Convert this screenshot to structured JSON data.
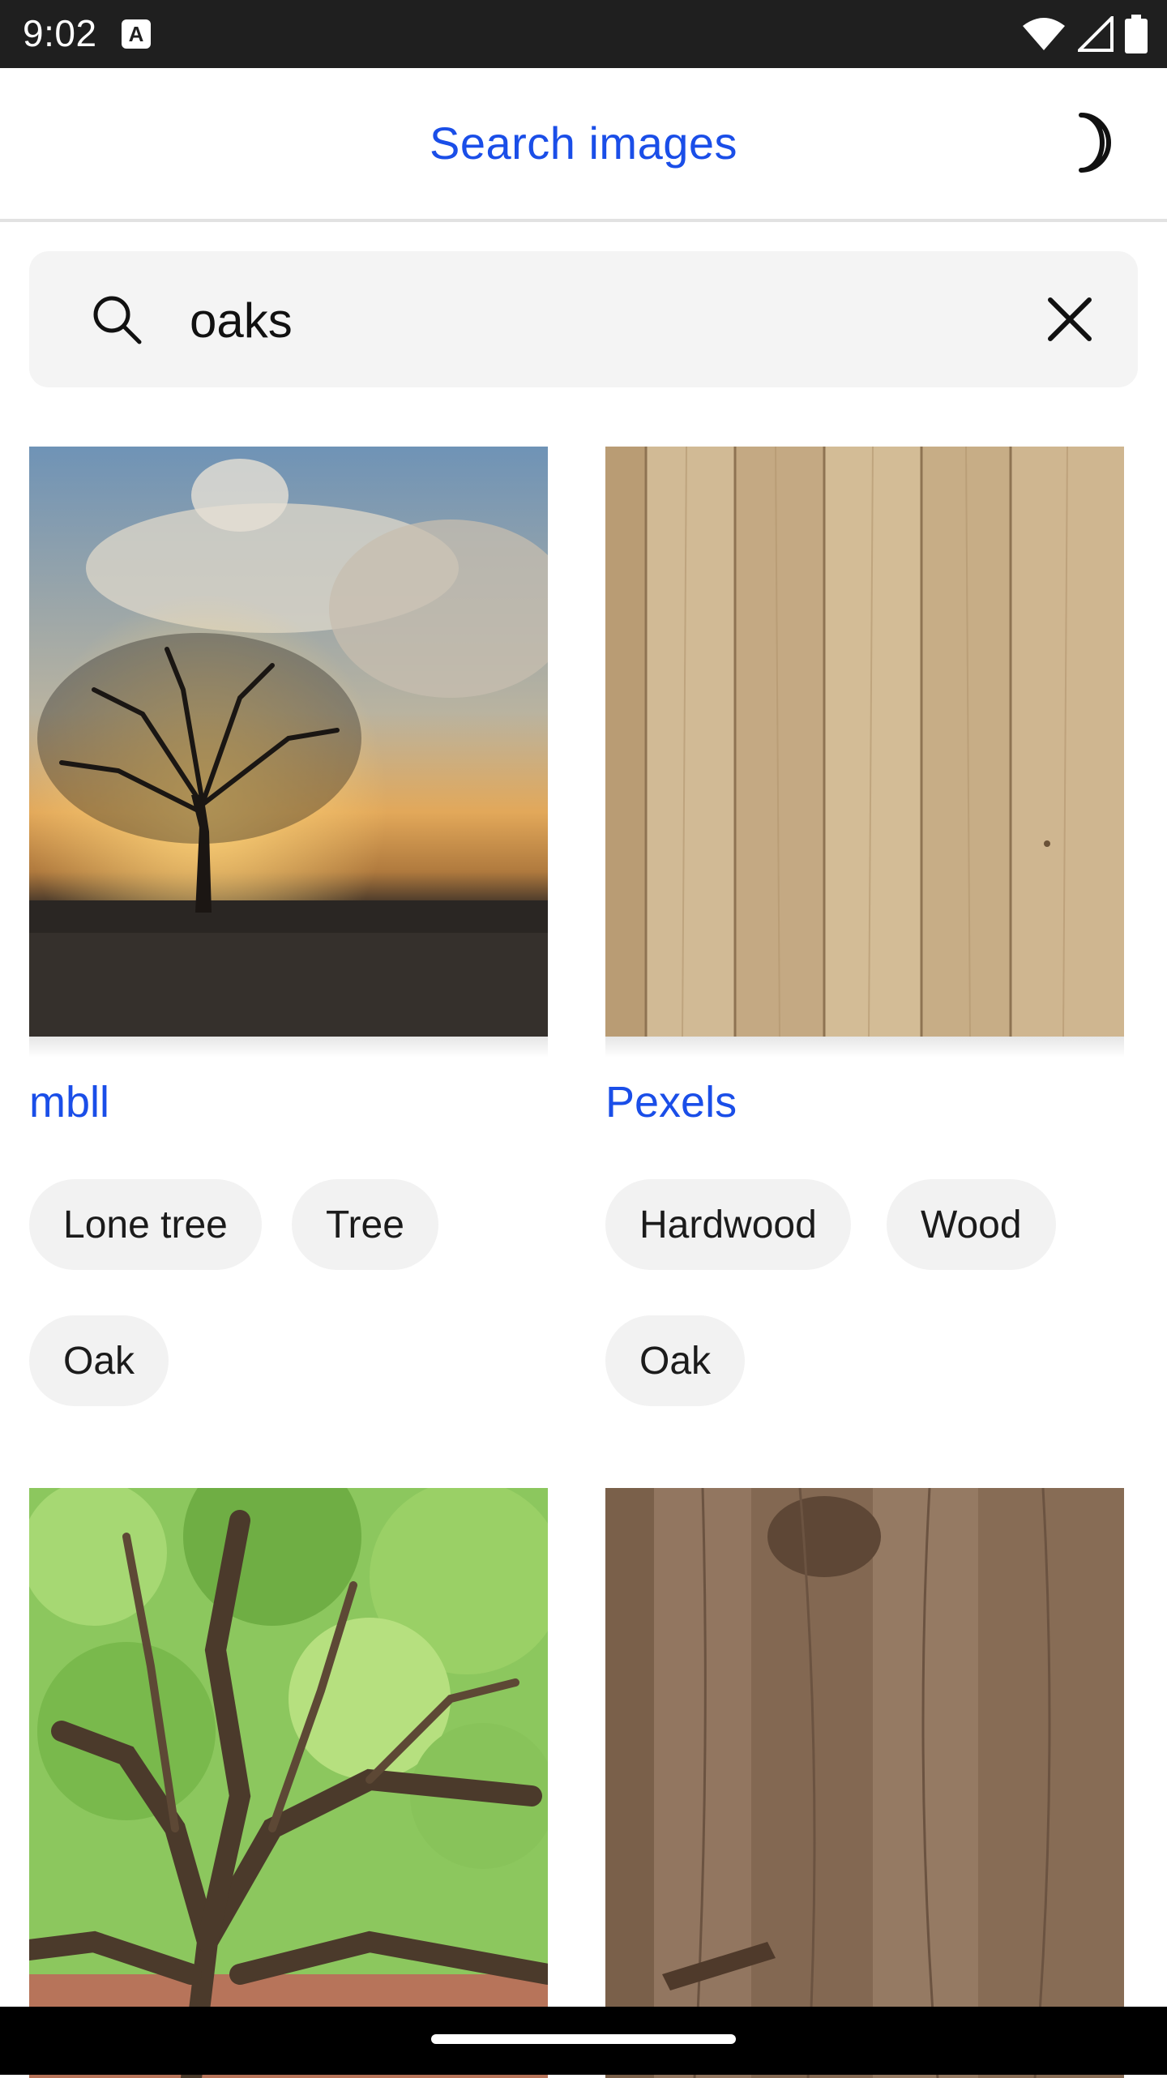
{
  "status_bar": {
    "time": "9:02",
    "notification_icon": "A",
    "icons": [
      "wifi-icon",
      "signal-icon",
      "battery-icon"
    ]
  },
  "app_bar": {
    "title": "Search images",
    "theme_icon": "moon-icon",
    "accent_color": "#1a4ee8"
  },
  "search": {
    "value": "oaks",
    "placeholder": "",
    "left_icon": "search-icon",
    "right_icon": "close-icon"
  },
  "results": [
    {
      "author": "mbll",
      "image": "lone-tree-sunset",
      "tags": [
        "Lone tree",
        "Tree",
        "Oak"
      ]
    },
    {
      "author": "Pexels",
      "image": "light-wood-planks",
      "tags": [
        "Hardwood",
        "Wood",
        "Oak"
      ]
    },
    {
      "author": "",
      "image": "green-oak-branches",
      "tags": []
    },
    {
      "author": "",
      "image": "dark-wood-planks",
      "tags": []
    }
  ]
}
